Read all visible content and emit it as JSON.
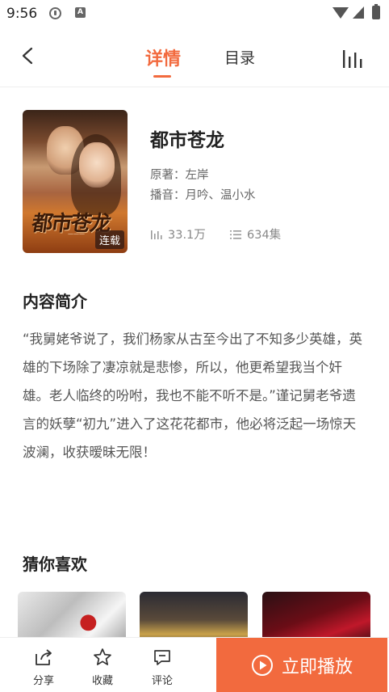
{
  "status_bar": {
    "time": "9:56",
    "icons": [
      "music-icon",
      "app-a-icon",
      "wifi-icon",
      "signal-icon",
      "battery-icon"
    ]
  },
  "header": {
    "tabs": [
      {
        "label": "详情",
        "active": true
      },
      {
        "label": "目录",
        "active": false
      }
    ],
    "accent_color": "#f26a3e"
  },
  "book": {
    "title": "都市苍龙",
    "cover_title": "都市苍龙",
    "status_badge": "连载",
    "author": "原著：左岸",
    "narrator": "播音：月吟、温小水",
    "plays": "33.1万",
    "episodes": "634集"
  },
  "intro": {
    "heading": "内容简介",
    "text": "“我舅姥爷说了，我们杨家从古至今出了不知多少英雄，英雄的下场除了凄凉就是悲惨，所以，他更希望我当个奸雄。老人临终的吩咐，我也不能不听不是。”谨记舅老爷遗言的妖孽“初九”进入了这花花都市，他必将泛起一场惊天波澜，收获暧昧无限！"
  },
  "recommend": {
    "heading": "猜你喜欢"
  },
  "bottom_bar": {
    "share": "分享",
    "favorite": "收藏",
    "comment": "评论",
    "play": "立即播放"
  }
}
